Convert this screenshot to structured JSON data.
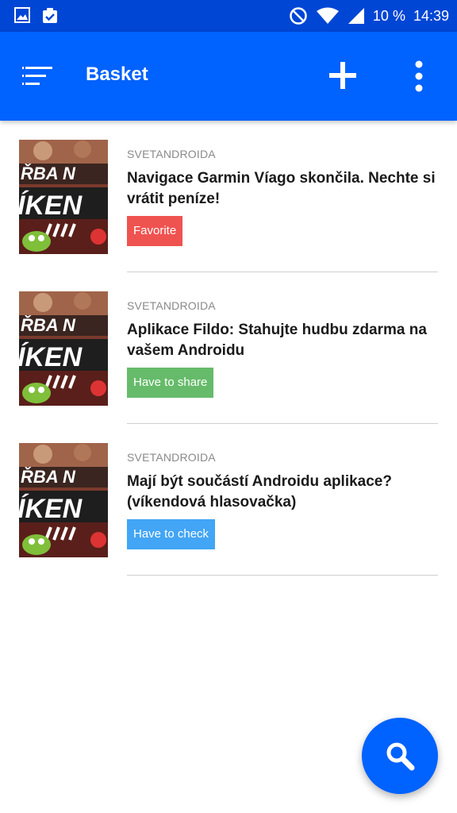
{
  "status_bar": {
    "battery_percent": "10 %",
    "time": "14:39",
    "icons": [
      "image-icon",
      "clipboard-check-icon",
      "do-not-disturb-icon",
      "wifi-icon",
      "signal-icon",
      "battery-icon"
    ]
  },
  "app_bar": {
    "title": "Basket",
    "icons": [
      "menu-icon",
      "add-icon",
      "more-vert-icon"
    ]
  },
  "colors": {
    "status_bar": "#0046d5",
    "app_bar": "#0062ff",
    "favorite": "#ef5350",
    "have_to_share": "#66bb6a",
    "have_to_check": "#42a5f5"
  },
  "items": [
    {
      "source": "SVETANDROIDA",
      "title": "Navigace Garmin Víago skončila. Nechte si vrátit peníze!",
      "tag": "Favorite",
      "tag_color": "#ef5350"
    },
    {
      "source": "SVETANDROIDA",
      "title": "Aplikace Fildo: Stahujte hudbu zdarma na vašem Androidu",
      "tag": "Have to share",
      "tag_color": "#66bb6a"
    },
    {
      "source": "SVETANDROIDA",
      "title": "Mají být součástí Androidu aplikace? (víkendová hlasovačka)",
      "tag": "Have to check",
      "tag_color": "#42a5f5"
    }
  ],
  "thumbnail_text": {
    "line1": "ŘBA N",
    "line2": "ÍKEN"
  },
  "fab": {
    "icon": "search-icon"
  }
}
